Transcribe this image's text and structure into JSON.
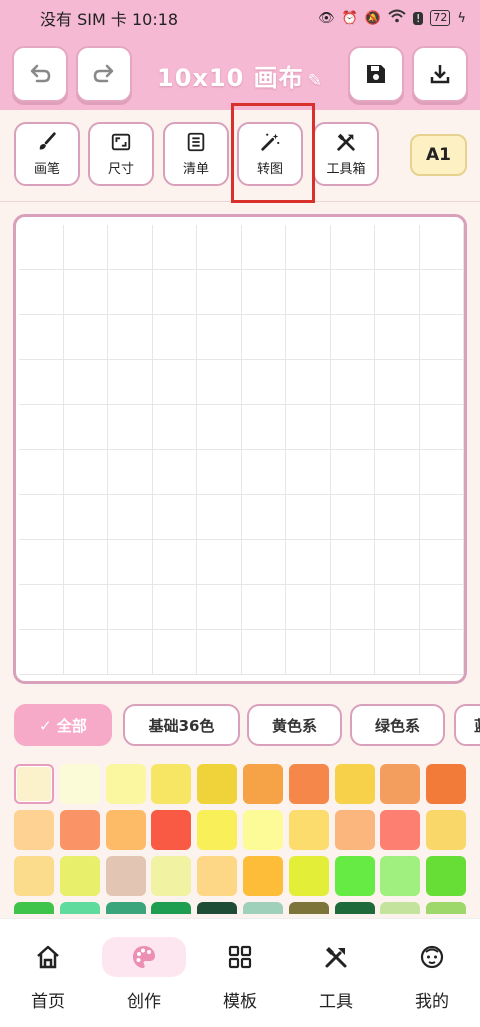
{
  "status": {
    "carrier": "没有 SIM 卡",
    "time": "10:18",
    "battery": "72"
  },
  "header": {
    "title": "10x10 画布",
    "edit_icon": "pencil-icon"
  },
  "toolbar": {
    "items": [
      {
        "label": "画笔",
        "icon": "brush-icon"
      },
      {
        "label": "尺寸",
        "icon": "resize-icon"
      },
      {
        "label": "清单",
        "icon": "list-icon"
      },
      {
        "label": "转图",
        "icon": "magic-wand-icon"
      },
      {
        "label": "工具箱",
        "icon": "tools-icon"
      }
    ],
    "color_code": "A1"
  },
  "canvas": {
    "cols": 10,
    "rows": 10
  },
  "filters": [
    {
      "label": "✓  全部",
      "active": true
    },
    {
      "label": "基础36色",
      "active": false
    },
    {
      "label": "黄色系",
      "active": false
    },
    {
      "label": "绿色系",
      "active": false
    },
    {
      "label": "蓝",
      "active": false
    }
  ],
  "palette": [
    "#fbf2cc",
    "#fcfbd8",
    "#fbf7a0",
    "#f7e663",
    "#f0d33b",
    "#f6a247",
    "#f5874a",
    "#f7d149",
    "#f39d5e",
    "#f27b3a",
    "#fdd293",
    "#fa9466",
    "#fdbb67",
    "#f95a44",
    "#f9ef58",
    "#fdfb97",
    "#fbdc6d",
    "#fbb67d",
    "#fd7f72",
    "#f9d769",
    "#fbdb8c",
    "#e7ef6b",
    "#e2c5b3",
    "#f1f2a2",
    "#fdd786",
    "#fdbd39",
    "#e3ee39",
    "#66eb44",
    "#9ff07e",
    "#67de35",
    "#3ec44b",
    "#5fdb9d",
    "#3aa57a",
    "#1f9d51",
    "#1d4d34",
    "#9fd0b9",
    "#7c7438",
    "#1e6a3a",
    "#c4e39c",
    "#9ed76a"
  ],
  "nav": [
    {
      "label": "首页",
      "icon": "home-icon",
      "active": false
    },
    {
      "label": "创作",
      "icon": "palette-icon",
      "active": true
    },
    {
      "label": "模板",
      "icon": "grid-icon",
      "active": false
    },
    {
      "label": "工具",
      "icon": "tools-icon",
      "active": false
    },
    {
      "label": "我的",
      "icon": "face-icon",
      "active": false
    }
  ]
}
